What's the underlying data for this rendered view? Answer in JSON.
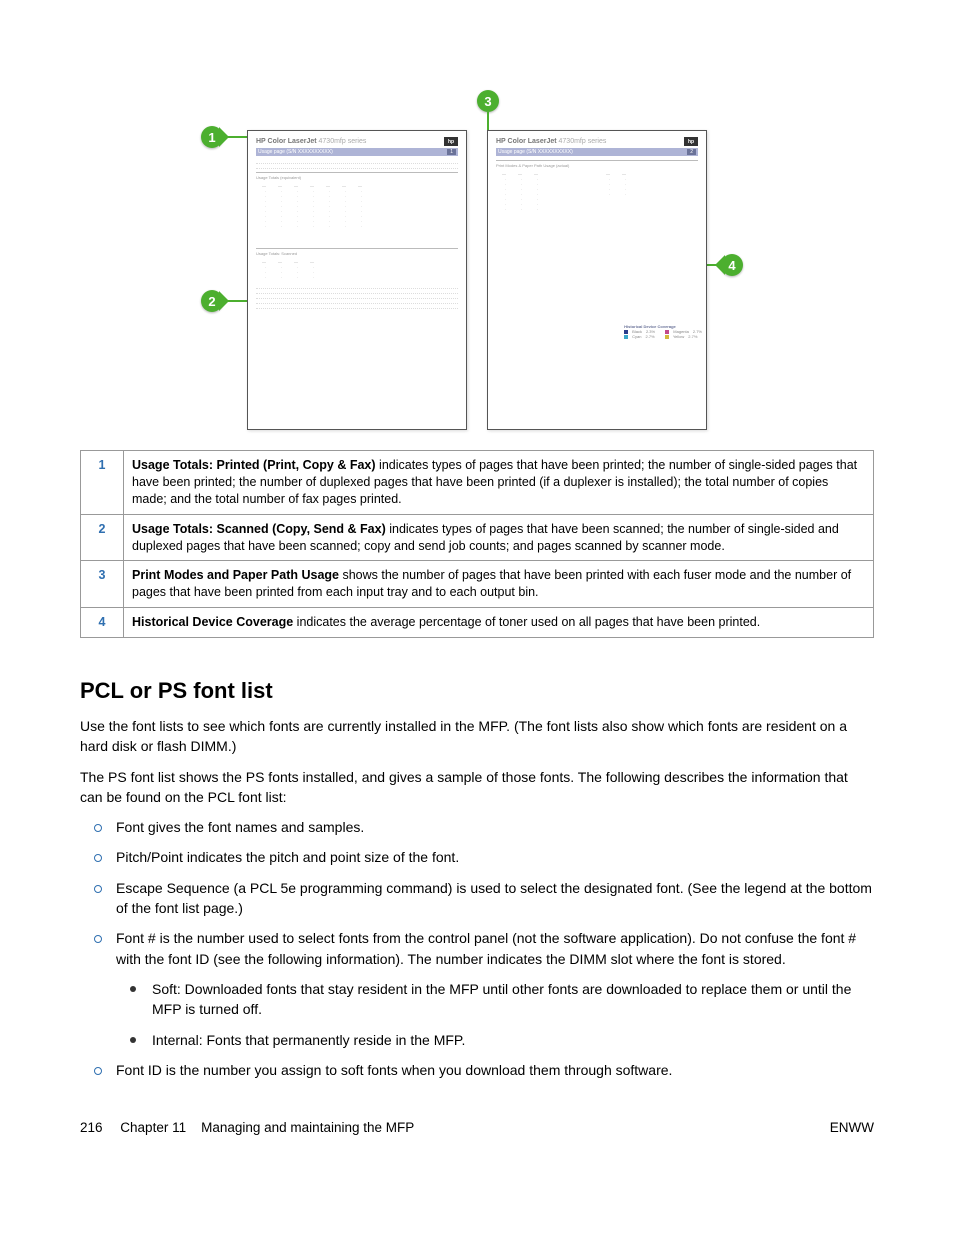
{
  "figure": {
    "sheet_title": "HP Color LaserJet",
    "sheet_model": "4730mfp series",
    "sheet_bar_text": "Usage page (S/N XXXXXXXXXX)",
    "left_pg": "1",
    "right_pg": "2",
    "section_a": "Usage Totals (equivalent)",
    "section_b": "Print Modes & Paper Path Usage (actual)",
    "toner_title": "Historical Device Coverage",
    "toner_k": "Black",
    "toner_k_v": "2.3%",
    "toner_c": "Cyan",
    "toner_c_v": "2.7%",
    "toner_m": "Magenta",
    "toner_m_v": "2.7%",
    "toner_y": "Yellow",
    "toner_y_v": "2.7%",
    "callouts": {
      "c1": "1",
      "c2": "2",
      "c3": "3",
      "c4": "4"
    }
  },
  "ref": [
    {
      "n": "1",
      "bold": "Usage Totals: Printed (Print, Copy & Fax)",
      "text": " indicates types of pages that have been printed; the number of single-sided pages that have been printed; the number of duplexed pages that have been printed (if a duplexer is installed); the total number of copies made; and the total number of fax pages printed."
    },
    {
      "n": "2",
      "bold": "Usage Totals: Scanned (Copy, Send & Fax)",
      "text": " indicates types of pages that have been scanned; the number of single-sided and duplexed pages that have been scanned; copy and send job counts; and pages scanned by scanner mode."
    },
    {
      "n": "3",
      "bold": "Print Modes and Paper Path Usage",
      "text": " shows the number of pages that have been printed with each fuser mode and the number of pages that have been printed from each input tray and to each output bin."
    },
    {
      "n": "4",
      "bold": "Historical Device Coverage",
      "text": " indicates the average percentage of toner used on all pages that have been printed."
    }
  ],
  "section_heading": "PCL or PS font list",
  "para1": "Use the font lists to see which fonts are currently installed in the MFP. (The font lists also show which fonts are resident on a hard disk or flash DIMM.)",
  "para2": "The PS font list shows the PS fonts installed, and gives a sample of those fonts. The following describes the information that can be found on the PCL font list:",
  "bullets": [
    "Font gives the font names and samples.",
    "Pitch/Point indicates the pitch and point size of the font.",
    "Escape Sequence (a PCL 5e programming command) is used to select the designated font. (See the legend at the bottom of the font list page.)",
    "Font # is the number used to select fonts from the control panel (not the software application). Do not confuse the font # with the font ID (see the following information). The number indicates the DIMM slot where the font is stored.",
    "Font ID is the number you assign to soft fonts when you download them through software."
  ],
  "sub_bullets": [
    "Soft: Downloaded fonts that stay resident in the MFP until other fonts are downloaded to replace them or until the MFP is turned off.",
    "Internal: Fonts that permanently reside in the MFP."
  ],
  "footer": {
    "page_num": "216",
    "chapter": "Chapter 11",
    "title": "Managing and maintaining the MFP",
    "right": "ENWW"
  }
}
